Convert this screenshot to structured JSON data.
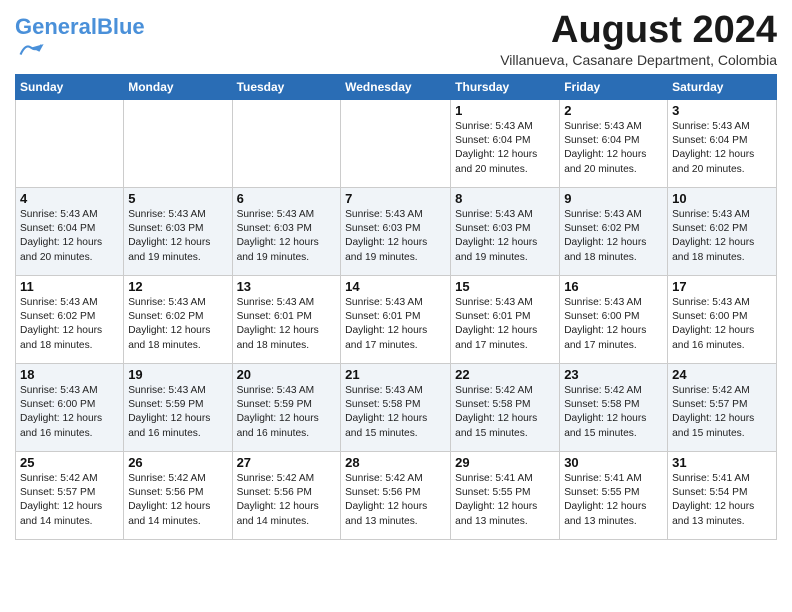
{
  "header": {
    "logo_general": "General",
    "logo_blue": "Blue",
    "month_title": "August 2024",
    "subtitle": "Villanueva, Casanare Department, Colombia"
  },
  "weekdays": [
    "Sunday",
    "Monday",
    "Tuesday",
    "Wednesday",
    "Thursday",
    "Friday",
    "Saturday"
  ],
  "weeks": [
    [
      {
        "day": "",
        "info": ""
      },
      {
        "day": "",
        "info": ""
      },
      {
        "day": "",
        "info": ""
      },
      {
        "day": "",
        "info": ""
      },
      {
        "day": "1",
        "info": "Sunrise: 5:43 AM\nSunset: 6:04 PM\nDaylight: 12 hours\nand 20 minutes."
      },
      {
        "day": "2",
        "info": "Sunrise: 5:43 AM\nSunset: 6:04 PM\nDaylight: 12 hours\nand 20 minutes."
      },
      {
        "day": "3",
        "info": "Sunrise: 5:43 AM\nSunset: 6:04 PM\nDaylight: 12 hours\nand 20 minutes."
      }
    ],
    [
      {
        "day": "4",
        "info": "Sunrise: 5:43 AM\nSunset: 6:04 PM\nDaylight: 12 hours\nand 20 minutes."
      },
      {
        "day": "5",
        "info": "Sunrise: 5:43 AM\nSunset: 6:03 PM\nDaylight: 12 hours\nand 19 minutes."
      },
      {
        "day": "6",
        "info": "Sunrise: 5:43 AM\nSunset: 6:03 PM\nDaylight: 12 hours\nand 19 minutes."
      },
      {
        "day": "7",
        "info": "Sunrise: 5:43 AM\nSunset: 6:03 PM\nDaylight: 12 hours\nand 19 minutes."
      },
      {
        "day": "8",
        "info": "Sunrise: 5:43 AM\nSunset: 6:03 PM\nDaylight: 12 hours\nand 19 minutes."
      },
      {
        "day": "9",
        "info": "Sunrise: 5:43 AM\nSunset: 6:02 PM\nDaylight: 12 hours\nand 18 minutes."
      },
      {
        "day": "10",
        "info": "Sunrise: 5:43 AM\nSunset: 6:02 PM\nDaylight: 12 hours\nand 18 minutes."
      }
    ],
    [
      {
        "day": "11",
        "info": "Sunrise: 5:43 AM\nSunset: 6:02 PM\nDaylight: 12 hours\nand 18 minutes."
      },
      {
        "day": "12",
        "info": "Sunrise: 5:43 AM\nSunset: 6:02 PM\nDaylight: 12 hours\nand 18 minutes."
      },
      {
        "day": "13",
        "info": "Sunrise: 5:43 AM\nSunset: 6:01 PM\nDaylight: 12 hours\nand 18 minutes."
      },
      {
        "day": "14",
        "info": "Sunrise: 5:43 AM\nSunset: 6:01 PM\nDaylight: 12 hours\nand 17 minutes."
      },
      {
        "day": "15",
        "info": "Sunrise: 5:43 AM\nSunset: 6:01 PM\nDaylight: 12 hours\nand 17 minutes."
      },
      {
        "day": "16",
        "info": "Sunrise: 5:43 AM\nSunset: 6:00 PM\nDaylight: 12 hours\nand 17 minutes."
      },
      {
        "day": "17",
        "info": "Sunrise: 5:43 AM\nSunset: 6:00 PM\nDaylight: 12 hours\nand 16 minutes."
      }
    ],
    [
      {
        "day": "18",
        "info": "Sunrise: 5:43 AM\nSunset: 6:00 PM\nDaylight: 12 hours\nand 16 minutes."
      },
      {
        "day": "19",
        "info": "Sunrise: 5:43 AM\nSunset: 5:59 PM\nDaylight: 12 hours\nand 16 minutes."
      },
      {
        "day": "20",
        "info": "Sunrise: 5:43 AM\nSunset: 5:59 PM\nDaylight: 12 hours\nand 16 minutes."
      },
      {
        "day": "21",
        "info": "Sunrise: 5:43 AM\nSunset: 5:58 PM\nDaylight: 12 hours\nand 15 minutes."
      },
      {
        "day": "22",
        "info": "Sunrise: 5:42 AM\nSunset: 5:58 PM\nDaylight: 12 hours\nand 15 minutes."
      },
      {
        "day": "23",
        "info": "Sunrise: 5:42 AM\nSunset: 5:58 PM\nDaylight: 12 hours\nand 15 minutes."
      },
      {
        "day": "24",
        "info": "Sunrise: 5:42 AM\nSunset: 5:57 PM\nDaylight: 12 hours\nand 15 minutes."
      }
    ],
    [
      {
        "day": "25",
        "info": "Sunrise: 5:42 AM\nSunset: 5:57 PM\nDaylight: 12 hours\nand 14 minutes."
      },
      {
        "day": "26",
        "info": "Sunrise: 5:42 AM\nSunset: 5:56 PM\nDaylight: 12 hours\nand 14 minutes."
      },
      {
        "day": "27",
        "info": "Sunrise: 5:42 AM\nSunset: 5:56 PM\nDaylight: 12 hours\nand 14 minutes."
      },
      {
        "day": "28",
        "info": "Sunrise: 5:42 AM\nSunset: 5:56 PM\nDaylight: 12 hours\nand 13 minutes."
      },
      {
        "day": "29",
        "info": "Sunrise: 5:41 AM\nSunset: 5:55 PM\nDaylight: 12 hours\nand 13 minutes."
      },
      {
        "day": "30",
        "info": "Sunrise: 5:41 AM\nSunset: 5:55 PM\nDaylight: 12 hours\nand 13 minutes."
      },
      {
        "day": "31",
        "info": "Sunrise: 5:41 AM\nSunset: 5:54 PM\nDaylight: 12 hours\nand 13 minutes."
      }
    ]
  ]
}
